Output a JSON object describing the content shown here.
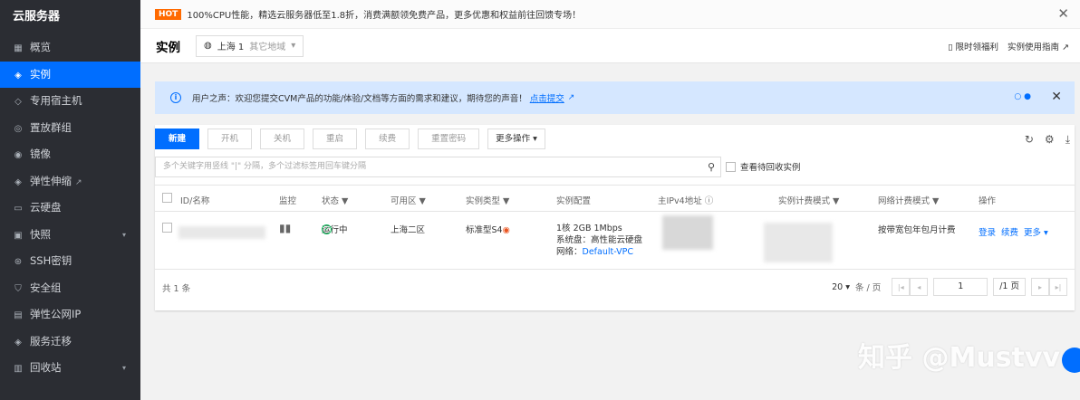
{
  "sidebar": {
    "brand": "云服务器",
    "items": [
      {
        "label": "概览",
        "icon": "grid-icon",
        "glyph": "▦"
      },
      {
        "label": "实例",
        "icon": "cube-icon",
        "glyph": "◈",
        "active": true
      },
      {
        "label": "专用宿主机",
        "icon": "layers-icon",
        "glyph": "◇"
      },
      {
        "label": "置放群组",
        "icon": "group-icon",
        "glyph": "◎"
      },
      {
        "label": "镜像",
        "icon": "disc-icon",
        "glyph": "◉"
      },
      {
        "label": "弹性伸缩",
        "icon": "scale-icon",
        "glyph": "◈",
        "external": true
      },
      {
        "label": "云硬盘",
        "icon": "disk-icon",
        "glyph": "▭"
      },
      {
        "label": "快照",
        "icon": "camera-icon",
        "glyph": "▣",
        "expand": true
      },
      {
        "label": "SSH密钥",
        "icon": "key-icon",
        "glyph": "⊛"
      },
      {
        "label": "安全组",
        "icon": "shield-icon",
        "glyph": "⛉"
      },
      {
        "label": "弹性公网IP",
        "icon": "ip-icon",
        "glyph": "▤"
      },
      {
        "label": "服务迁移",
        "icon": "migrate-icon",
        "glyph": "◈"
      },
      {
        "label": "回收站",
        "icon": "trash-icon",
        "glyph": "▥",
        "expand": true
      }
    ]
  },
  "notice": {
    "badge": "HOT",
    "text": "100%CPU性能，精选云服务器低至1.8折，消费满额领免费产品，更多优惠和权益前往回馈专场！"
  },
  "header": {
    "title": "实例",
    "region": "上海 1",
    "other_regions": "其它地域",
    "link1": "限时领福利",
    "link2": "实例使用指南"
  },
  "feedback": {
    "text": "用户之声：欢迎您提交CVM产品的功能/体验/文档等方面的需求和建议，期待您的声音！",
    "link": "点击提交"
  },
  "toolbar": {
    "new": "新建",
    "start": "开机",
    "stop": "关机",
    "restart": "重启",
    "renew": "续费",
    "reset_pwd": "重置密码",
    "more": "更多操作"
  },
  "search": {
    "placeholder": "多个关键字用竖线 \"|\" 分隔，多个过滤标签用回车键分隔",
    "recycle_label": "查看待回收实例"
  },
  "table": {
    "headers": {
      "id": "ID/名称",
      "monitor": "监控",
      "status": "状态",
      "zone": "可用区",
      "type": "实例类型",
      "config": "实例配置",
      "ip": "主IPv4地址",
      "billing": "实例计费模式",
      "net_billing": "网络计费模式",
      "ops": "操作"
    },
    "row": {
      "status": "运行中",
      "zone": "上海二区",
      "type": "标准型S4",
      "config1": "1核 2GB 1Mbps",
      "config2": "系统盘：高性能云硬盘",
      "config3_label": "网络：",
      "config3_link": "Default-VPC",
      "net_billing": "按带宽包年包月计费",
      "op_login": "登录",
      "op_renew": "续费",
      "op_more": "更多"
    }
  },
  "footer": {
    "total": "共 1 条",
    "page_size": "20",
    "page_unit": "条 / 页",
    "page": "1",
    "page_total": "/1 页"
  },
  "watermark": "知乎 @Mustvv"
}
